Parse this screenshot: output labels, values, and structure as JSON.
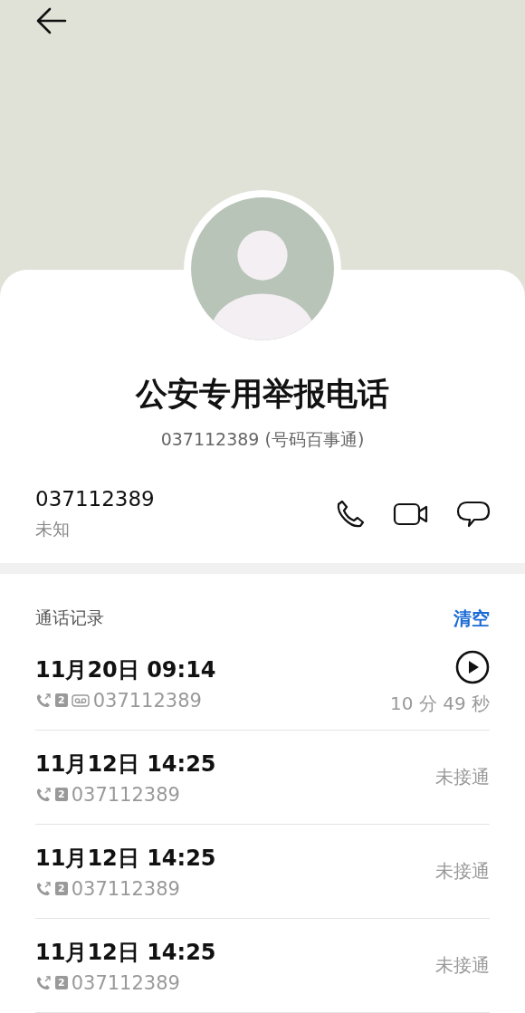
{
  "contact": {
    "name": "公安专用举报电话",
    "subtitle": "037112389 (号码百事通)",
    "number": "037112389",
    "label": "未知"
  },
  "call_log": {
    "title": "通话记录",
    "clear": "清空",
    "rows": [
      {
        "datetime": "11月20日 09:14",
        "sim": "2",
        "voicemail": true,
        "recording": true,
        "number": "037112389",
        "status": "10 分 49 秒"
      },
      {
        "datetime": "11月12日 14:25",
        "sim": "2",
        "voicemail": false,
        "recording": false,
        "number": "037112389",
        "status": "未接通"
      },
      {
        "datetime": "11月12日 14:25",
        "sim": "2",
        "voicemail": false,
        "recording": false,
        "number": "037112389",
        "status": "未接通"
      },
      {
        "datetime": "11月12日 14:25",
        "sim": "2",
        "voicemail": false,
        "recording": false,
        "number": "037112389",
        "status": "未接通"
      }
    ]
  }
}
